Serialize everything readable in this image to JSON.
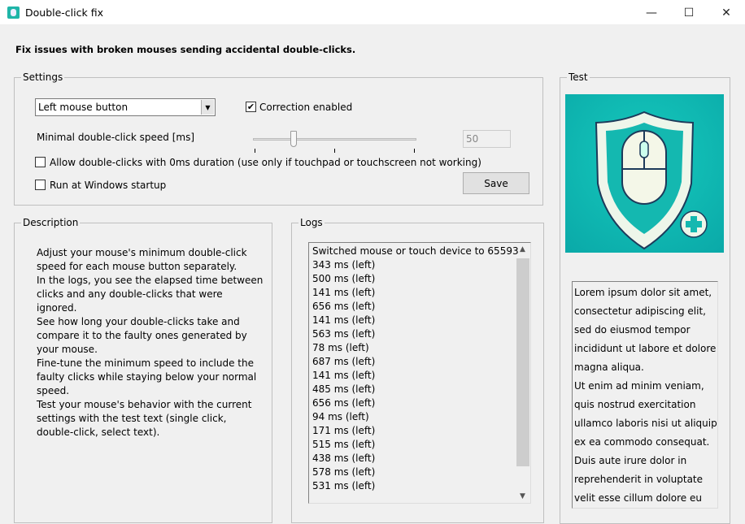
{
  "window": {
    "title": "Double-click fix",
    "minimize": "—",
    "maximize": "☐",
    "close": "✕"
  },
  "headline": "Fix issues with broken mouses sending accidental double-clicks.",
  "settings": {
    "label": "Settings",
    "button_select": "Left mouse button",
    "correction_label": "Correction enabled",
    "correction_checked": true,
    "speed_label": "Minimal double-click speed [ms]",
    "slider": {
      "value": 50,
      "min": 0,
      "max": 200
    },
    "speed_value": "50",
    "allow_zero_label": "Allow double-clicks with 0ms duration (use only if touchpad or touchscreen not working)",
    "allow_zero_checked": false,
    "startup_label": "Run at Windows startup",
    "startup_checked": false,
    "save_label": "Save"
  },
  "description": {
    "label": "Description",
    "text": "Adjust your mouse's minimum double-click speed for each mouse button separately.\nIn the logs, you see the elapsed time between clicks and any double-clicks that were ignored.\nSee how long your double-clicks take and compare it to the faulty ones generated by your mouse.\nFine-tune the minimum speed to include the faulty clicks while staying below your normal speed.\nTest your mouse's behavior with the current settings with the test text (single click, double-click, select text)."
  },
  "logs": {
    "label": "Logs",
    "entries": [
      "Switched mouse or touch device to 65593",
      "343 ms (left)",
      "500 ms (left)",
      "141 ms (left)",
      "656 ms (left)",
      "141 ms (left)",
      "563 ms (left)",
      "78 ms (left)",
      "687 ms (left)",
      "141 ms (left)",
      "485 ms (left)",
      "656 ms (left)",
      "94 ms (left)",
      "171 ms (left)",
      "515 ms (left)",
      "438 ms (left)",
      "578 ms (left)",
      "531 ms (left)"
    ]
  },
  "test": {
    "label": "Test",
    "logo_icon": "shield-mouse-logo",
    "text": "Lorem ipsum dolor sit amet,\nconsectetur adipiscing elit,\nsed do eiusmod tempor\nincididunt ut labore et dolore\nmagna aliqua.\nUt enim ad minim veniam,\nquis nostrud exercitation\nullamco laboris nisi ut aliquip\nex ea commodo consequat.\nDuis aute irure dolor in\nreprehenderit in voluptate\nvelit esse cillum dolore eu"
  }
}
